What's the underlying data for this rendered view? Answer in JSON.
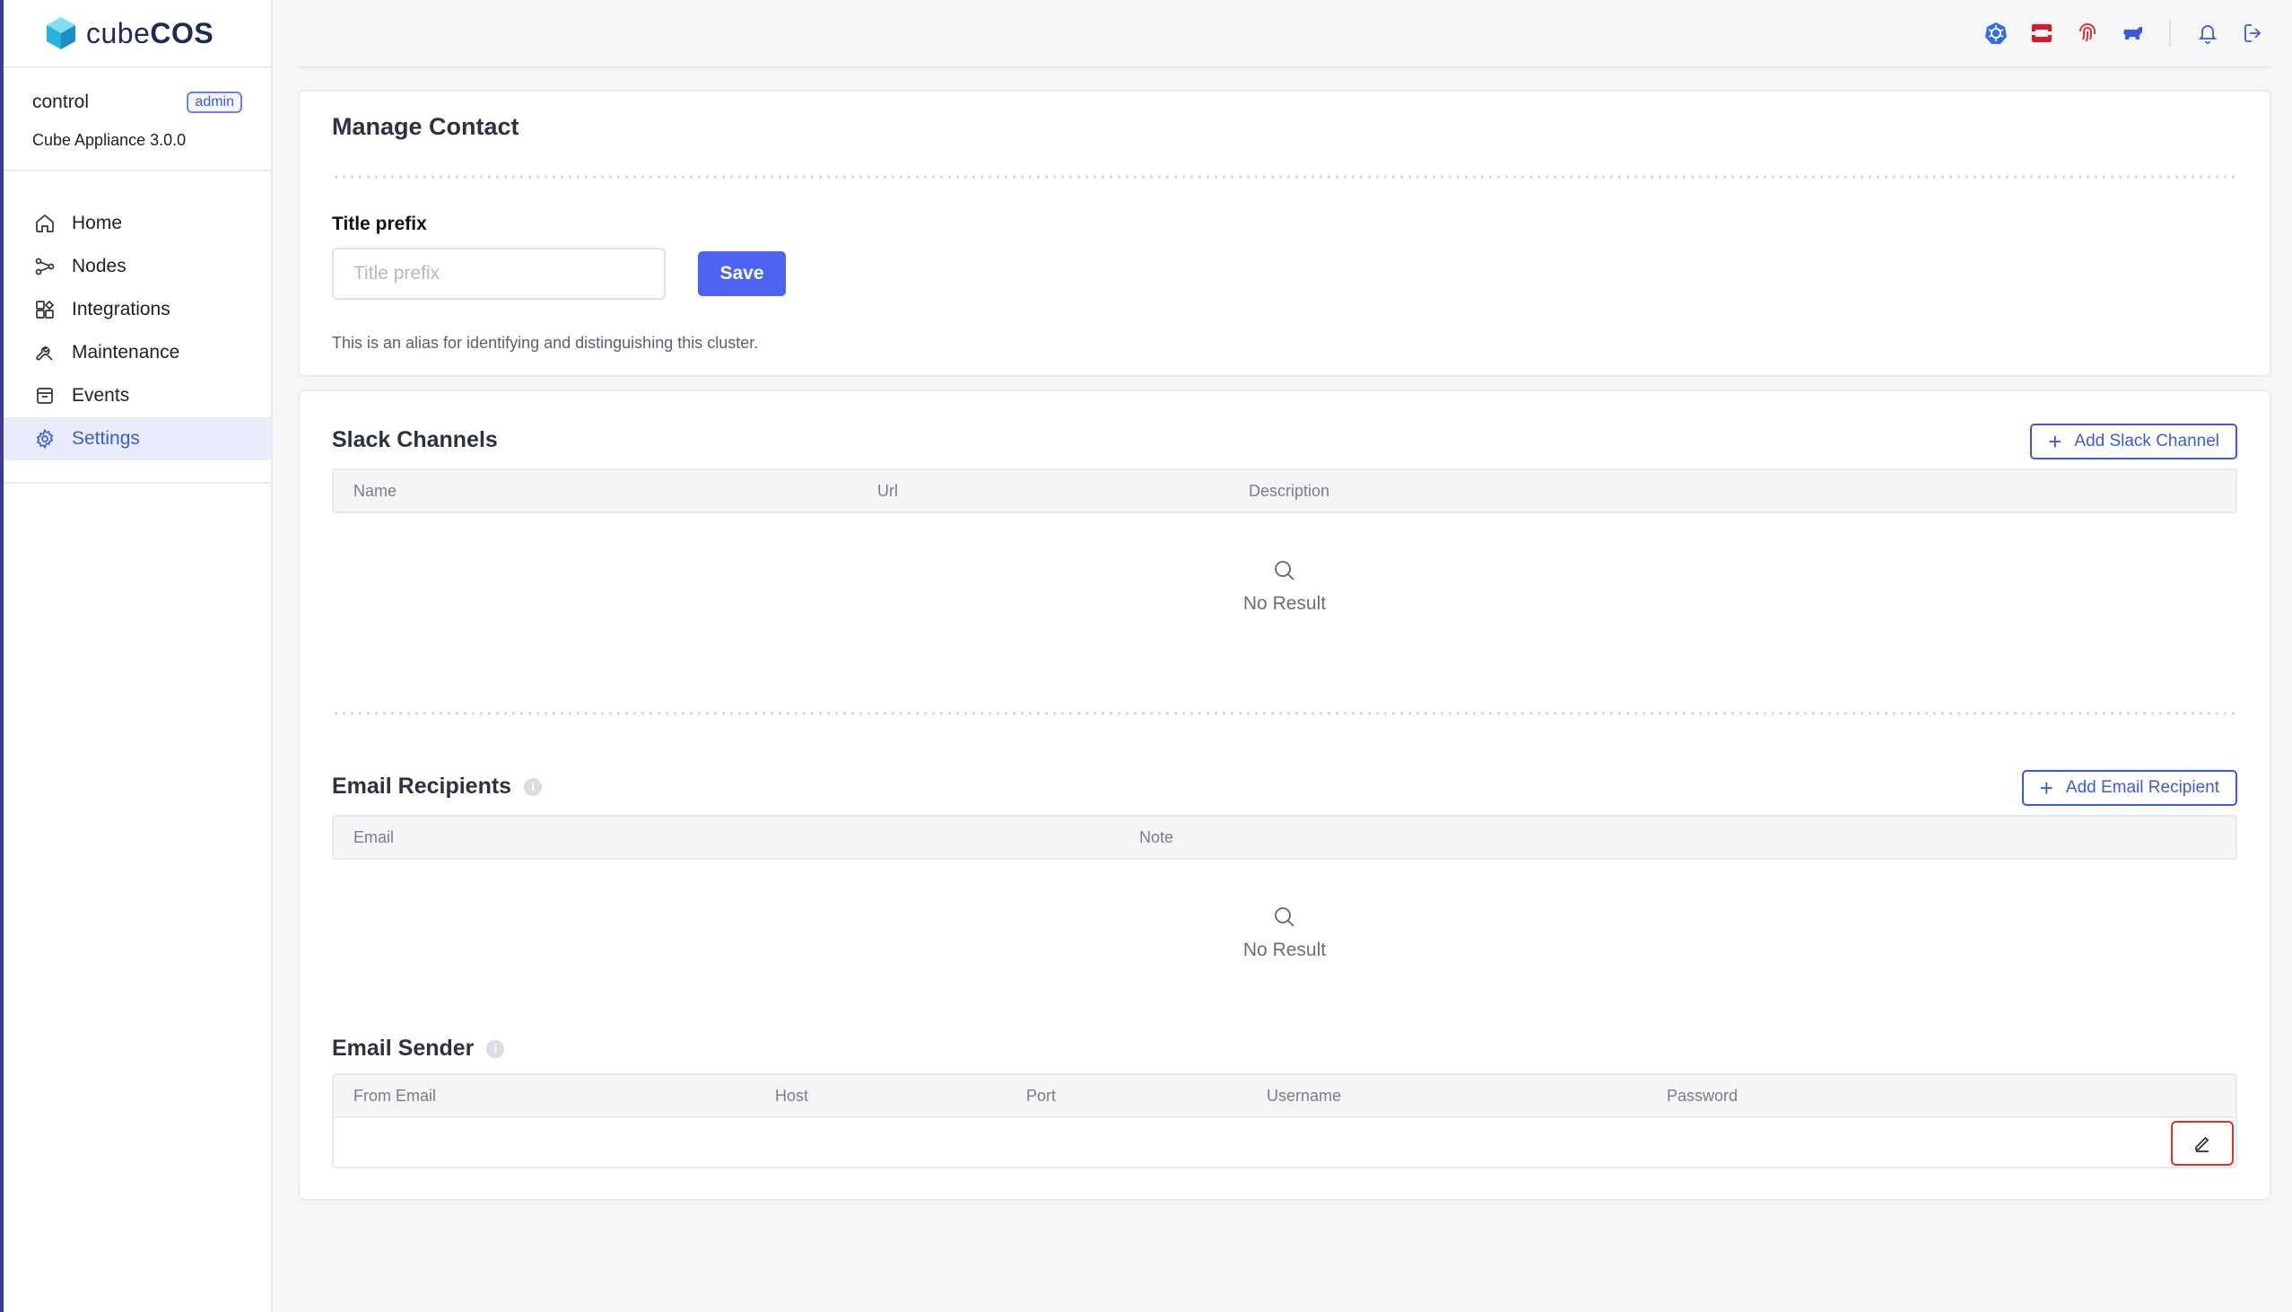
{
  "brand": {
    "name_light": "cube",
    "name_bold": "COS"
  },
  "context": {
    "node": "control",
    "role_badge": "admin",
    "version": "Cube Appliance 3.0.0"
  },
  "nav": {
    "items": [
      {
        "label": "Home",
        "icon": "home-icon"
      },
      {
        "label": "Nodes",
        "icon": "nodes-icon"
      },
      {
        "label": "Integrations",
        "icon": "integrations-icon"
      },
      {
        "label": "Maintenance",
        "icon": "wrench-icon"
      },
      {
        "label": "Events",
        "icon": "events-icon"
      },
      {
        "label": "Settings",
        "icon": "gear-icon",
        "active": true
      }
    ]
  },
  "topbar": {
    "icons": [
      "kubernetes-icon",
      "openstack-icon",
      "fingerprint-icon",
      "cloud-icon",
      "bell-icon",
      "logout-icon"
    ],
    "colors": {
      "kubernetes": "#326ce5",
      "openstack": "#e0162b",
      "fingerprint": "#e03131",
      "cloud": "#3b5bdb"
    }
  },
  "manage_contact": {
    "title": "Manage Contact",
    "title_prefix": {
      "label": "Title prefix",
      "placeholder": "Title prefix",
      "value": "",
      "save_label": "Save",
      "hint": "This is an alias for identifying and distinguishing this cluster."
    }
  },
  "slack": {
    "title": "Slack Channels",
    "add_label": "Add Slack Channel",
    "columns": [
      "Name",
      "Url",
      "Description"
    ],
    "rows": [],
    "empty_text": "No Result"
  },
  "email_recipients": {
    "title": "Email Recipients",
    "add_label": "Add Email Recipient",
    "columns": [
      "Email",
      "Note"
    ],
    "rows": [],
    "empty_text": "No Result"
  },
  "email_sender": {
    "title": "Email Sender",
    "columns": [
      "From Email",
      "Host",
      "Port",
      "Username",
      "Password"
    ],
    "row": {
      "from_email": "",
      "host": "",
      "port": "",
      "username": "",
      "password": ""
    }
  },
  "colors": {
    "accent": "#4b63f0",
    "sidebar_active_bg": "#e9ecfb",
    "edit_highlight": "#e03131"
  }
}
